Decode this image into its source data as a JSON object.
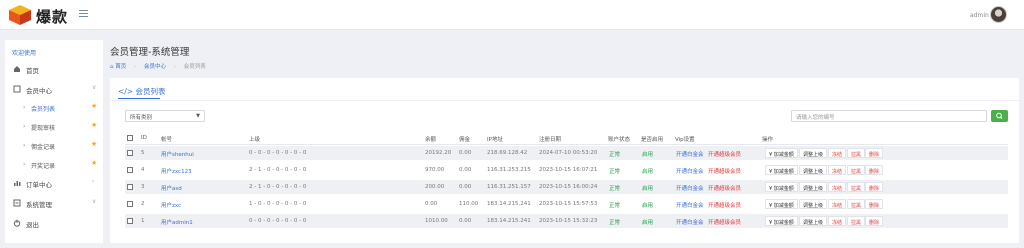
{
  "header": {
    "brand": "爆款",
    "admin_name": "admin"
  },
  "sidebar": {
    "title": "欢迎使用",
    "home": "首页",
    "member_center": "会员中心",
    "sub_items": [
      "会员列表",
      "提现审核",
      "佣金记录",
      "开奖记录"
    ],
    "order_center": "订单中心",
    "system": "系统管理",
    "logout": "退出"
  },
  "page": {
    "title": "会员管理-系统管理",
    "breadcrumb": [
      "首页",
      "会员中心",
      "会员列表"
    ]
  },
  "card": {
    "title": "会员列表",
    "filter_value": "所有类别",
    "search_placeholder": "请输入您的编号"
  },
  "table": {
    "headers": [
      "ID",
      "帐号",
      "上级",
      "余额",
      "佣金",
      "IP地址",
      "注册日期",
      "账户状态",
      "是否启用",
      "Vip设置",
      "操作"
    ],
    "rows": [
      {
        "id": "5",
        "account": "用户shenhui",
        "parent": "0 - 0 - 0 - 0 - 0 - 0 - 0",
        "balance": "20192.20",
        "commission": "0.00",
        "ip": "218.69.128.42",
        "date": "2024-07-10 00:53:20",
        "status": "正常",
        "enabled": "启用",
        "vip": [
          "开通白金会",
          "开通超级会员"
        ]
      },
      {
        "id": "4",
        "account": "用户zxc123",
        "parent": "2 - 1 - 0 - 0 - 0 - 0 - 0",
        "balance": "970.00",
        "commission": "0.00",
        "ip": "116.31.253.215",
        "date": "2023-10-15 16:07:21",
        "status": "正常",
        "enabled": "启用",
        "vip": [
          "开通白金会",
          "开通超级会员"
        ]
      },
      {
        "id": "3",
        "account": "用户asd",
        "parent": "2 - 1 - 0 - 0 - 0 - 0 - 0",
        "balance": "200.00",
        "commission": "0.00",
        "ip": "116.31.251.157",
        "date": "2023-10-15 16:00:24",
        "status": "正常",
        "enabled": "启用",
        "vip": [
          "开通白金会",
          "开通超级会员"
        ]
      },
      {
        "id": "2",
        "account": "用户zxc",
        "parent": "1 - 0 - 0 - 0 - 0 - 0 - 0",
        "balance": "0.00",
        "commission": "110.00",
        "ip": "183.14.215.241",
        "date": "2023-10-15 15:57:53",
        "status": "正常",
        "enabled": "启用",
        "vip": [
          "开通白金会",
          "开通超级会员"
        ]
      },
      {
        "id": "1",
        "account": "用户admin1",
        "parent": "0 - 0 - 0 - 0 - 0 - 0 - 0",
        "balance": "1010.00",
        "commission": "0.00",
        "ip": "183.14.215.241",
        "date": "2023-10-15 15:32:23",
        "status": "正常",
        "enabled": "启用",
        "vip": [
          "开通白金会",
          "开通超级会员"
        ]
      }
    ],
    "actions": [
      "¥ 加减金额",
      "调整上级",
      "冻结",
      "拉黑",
      "删除"
    ]
  },
  "colors": {
    "accent": "#3b6fd1",
    "green": "#22a04b",
    "red": "#e33b3b",
    "star": "#f5a623"
  }
}
